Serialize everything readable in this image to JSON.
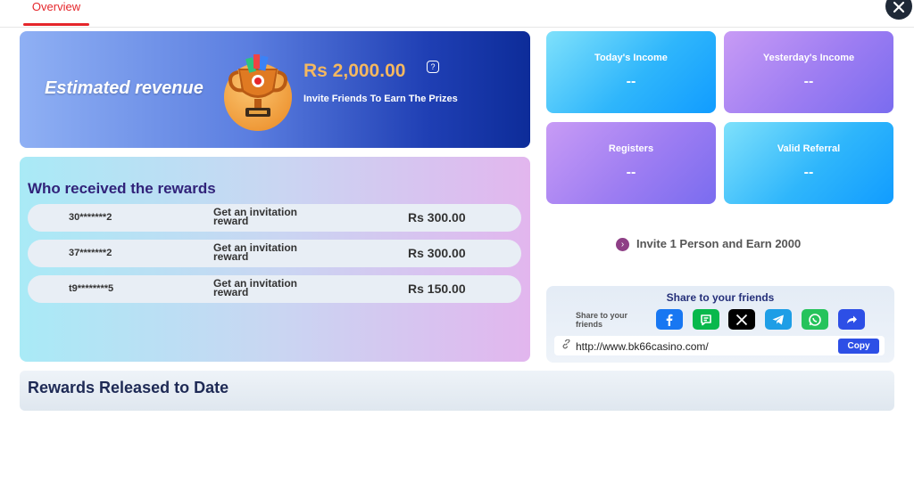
{
  "tabs": [
    {
      "label": "Overview",
      "active": true
    }
  ],
  "close_icon": "close-icon",
  "revenue": {
    "title": "Estimated revenue",
    "amount": "Rs  2,000.00",
    "subtitle": "Invite Friends To Earn The Prizes",
    "trophy_icon": "trophy-icon",
    "info_icon": "info-icon"
  },
  "received": {
    "title": "Who received the rewards",
    "rows": [
      {
        "id": "30*******2",
        "desc_line1": "Get an invitation",
        "desc_line2": "reward",
        "amount": "Rs  300.00"
      },
      {
        "id": "37*******2",
        "desc_line1": "Get an invitation",
        "desc_line2": "reward",
        "amount": "Rs  300.00"
      },
      {
        "id": "t9********5",
        "desc_line1": "Get an invitation",
        "desc_line2": "reward",
        "amount": "Rs  150.00"
      }
    ]
  },
  "stats": [
    {
      "label": "Today's Income",
      "value": "--"
    },
    {
      "label": "Yesterday's Income",
      "value": "--"
    },
    {
      "label": "Registers",
      "value": "--"
    },
    {
      "label": "Valid Referral",
      "value": "--"
    }
  ],
  "invite_line": "Invite 1 Person and Earn 2000",
  "share": {
    "title": "Share to your friends",
    "label_line1": "Share to your",
    "label_line2": "friends",
    "icons": [
      "facebook-icon",
      "message-icon",
      "x-icon",
      "telegram-icon",
      "whatsapp-icon",
      "forward-icon"
    ],
    "link": "http://www.bk66casino.com/",
    "copy_label": "Copy"
  },
  "released_title": "Rewards Released to Date",
  "colors": {
    "accent_red": "#e5262b",
    "amount_gold": "#f4b860",
    "title_purple": "#31237a",
    "copy_blue": "#2d4fe6"
  }
}
